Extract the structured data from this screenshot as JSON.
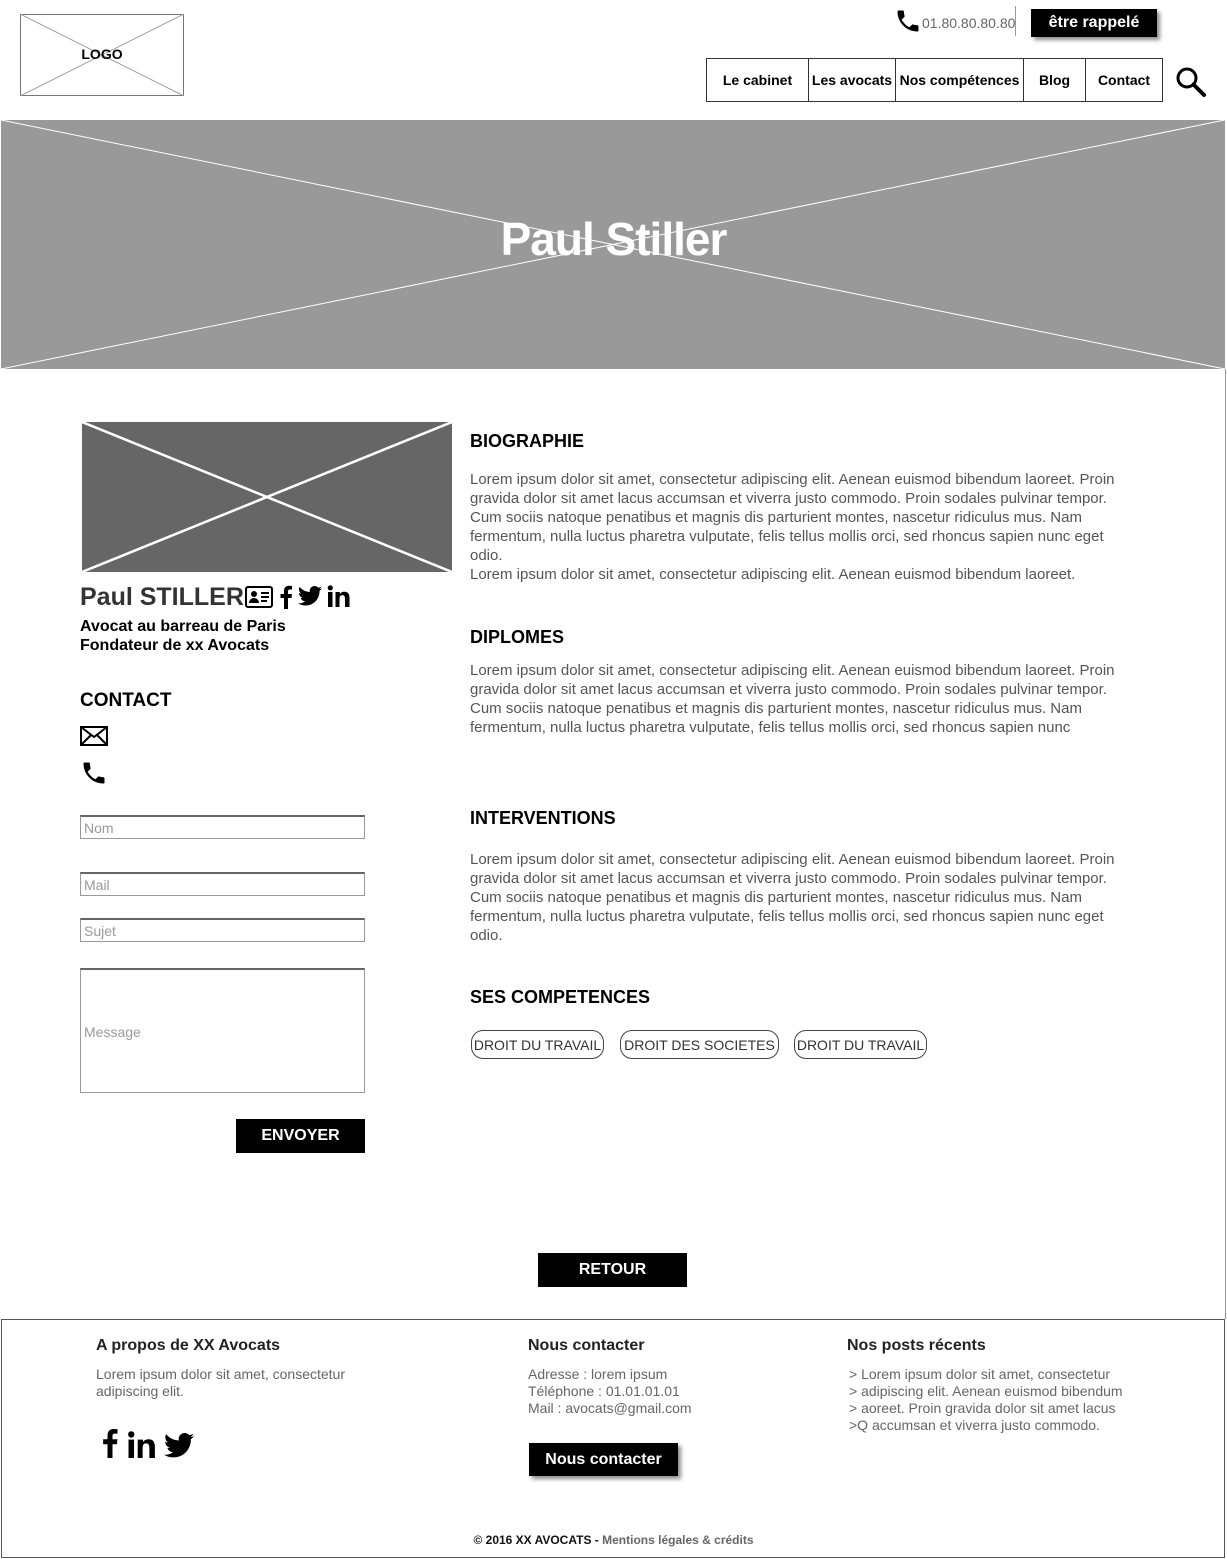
{
  "header": {
    "logo": "LOGO",
    "phone": "01.80.80.80.80",
    "callback_label": "être rappelé",
    "nav": [
      "Le cabinet",
      "Les avocats",
      "Nos compétences",
      "Blog",
      "Contact"
    ]
  },
  "hero": {
    "title": "Paul Stiller"
  },
  "profile": {
    "name": "Paul STILLER",
    "role1": "Avocat au barreau de Paris",
    "role2": "Fondateur de xx Avocats"
  },
  "contact": {
    "heading": "CONTACT",
    "form": {
      "name_placeholder": "Nom",
      "mail_placeholder": "Mail",
      "subject_placeholder": "Sujet",
      "message_placeholder": "Message",
      "send_label": "ENVOYER"
    }
  },
  "sections": {
    "bio_title": "BIOGRAPHIE",
    "bio_text": "Lorem ipsum dolor sit amet, consectetur adipiscing elit. Aenean euismod bibendum laoreet. Proin gravida dolor sit amet lacus accumsan et viverra justo commodo. Proin sodales pulvinar tempor. Cum sociis natoque penatibus et magnis dis parturient montes, nascetur ridiculus mus. Nam fermentum, nulla luctus pharetra vulputate, felis tellus mollis orci, sed rhoncus sapien nunc eget odio.",
    "bio_text2": "Lorem ipsum dolor sit amet, consectetur adipiscing elit. Aenean euismod bibendum laoreet.",
    "diplomas_title": "DIPLOMES",
    "diplomas_text": "Lorem ipsum dolor sit amet, consectetur adipiscing elit. Aenean euismod bibendum laoreet. Proin gravida dolor sit amet lacus accumsan et viverra justo commodo. Proin sodales pulvinar tempor. Cum sociis natoque penatibus et magnis dis parturient montes, nascetur ridiculus mus. Nam fermentum, nulla luctus pharetra vulputate, felis tellus mollis orci, sed rhoncus sapien nunc",
    "interventions_title": "INTERVENTIONS",
    "interventions_text": "Lorem ipsum dolor sit amet, consectetur adipiscing elit. Aenean euismod bibendum laoreet. Proin gravida dolor sit amet lacus accumsan et viverra justo commodo. Proin sodales pulvinar tempor. Cum sociis natoque penatibus et magnis dis parturient montes, nascetur ridiculus mus. Nam fermentum, nulla luctus pharetra vulputate, felis tellus mollis orci, sed rhoncus sapien nunc eget odio.",
    "skills_title": "SES COMPETENCES",
    "skills": [
      "DROIT DU TRAVAIL",
      "DROIT DES SOCIETES",
      "DROIT DU TRAVAIL"
    ]
  },
  "back_label": "RETOUR",
  "footer": {
    "about_title": "A propos de XX Avocats",
    "about_line1": "Lorem ipsum dolor sit amet, consectetur",
    "about_line2": "adipiscing elit.",
    "contact_title": "Nous contacter",
    "address": "Adresse : lorem ipsum",
    "telephone": "Téléphone : 01.01.01.01",
    "mail": "Mail : avocats@gmail.com",
    "contact_btn": "Nous contacter",
    "posts_title": "Nos posts récents",
    "posts": [
      "> Lorem ipsum dolor sit amet, consectetur",
      "> adipiscing elit. Aenean euismod bibendum",
      "> aoreet. Proin gravida dolor sit amet lacus",
      ">Q accumsan et viverra justo commodo."
    ],
    "copyright": "© 2016 XX AVOCATS -",
    "legal": "Mentions légales & crédits"
  },
  "colors": {
    "hero_bg": "#999999",
    "photo_bg": "#666666",
    "button_bg": "#000000"
  },
  "icons": [
    "phone-icon",
    "search-icon",
    "vcard-icon",
    "facebook-icon",
    "twitter-icon",
    "linkedin-icon",
    "mail-icon"
  ]
}
